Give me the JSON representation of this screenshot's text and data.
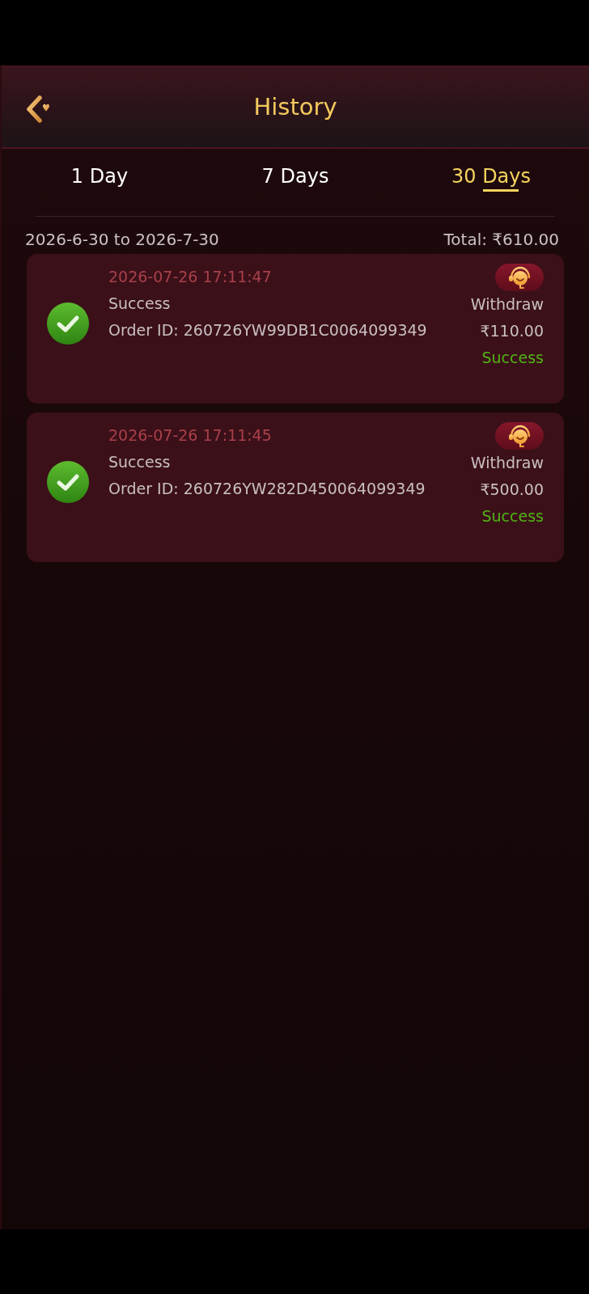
{
  "header": {
    "title": "History"
  },
  "tabs": [
    {
      "label": "1 Day",
      "selected": false
    },
    {
      "label": "7 Days",
      "selected": false
    },
    {
      "label": "30 Days",
      "selected": true
    }
  ],
  "summary": {
    "date_range": "2026-6-30 to 2026-7-30",
    "total": "Total: ₹610.00"
  },
  "records": [
    {
      "time": "2026-07-26 17:11:47",
      "status": "Success",
      "order_id": "Order ID: 260726YW99DB1C0064099349",
      "type": "Withdraw",
      "amount": "₹110.00",
      "result": "Success"
    },
    {
      "time": "2026-07-26 17:11:45",
      "status": "Success",
      "order_id": "Order ID: 260726YW282D450064099349",
      "type": "Withdraw",
      "amount": "₹500.00",
      "result": "Success"
    }
  ]
}
